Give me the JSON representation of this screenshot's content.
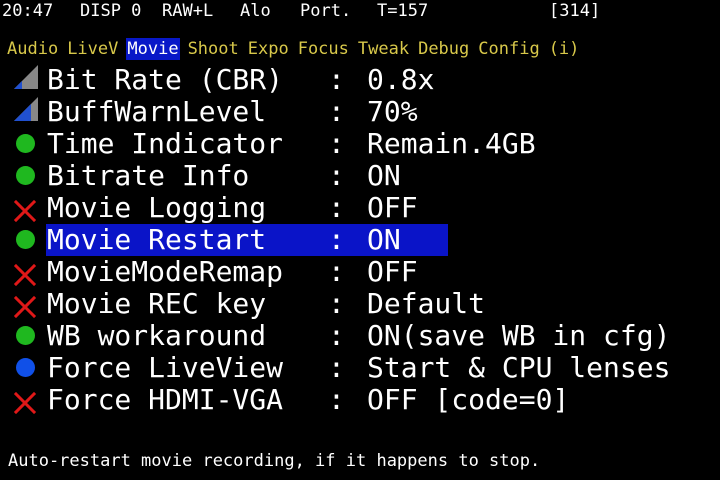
{
  "status": {
    "time": "20:47",
    "disp": "DISP 0",
    "quality": "RAW+L",
    "iso_mode": "Alo",
    "orientation": "Port.",
    "temperature": "T=157",
    "shots": "[314]"
  },
  "tabs": [
    {
      "label": "Audio",
      "active": false
    },
    {
      "label": "LiveV",
      "active": false
    },
    {
      "label": "Movie",
      "active": true
    },
    {
      "label": "Shoot",
      "active": false
    },
    {
      "label": "Expo",
      "active": false
    },
    {
      "label": "Focus",
      "active": false
    },
    {
      "label": "Tweak",
      "active": false
    },
    {
      "label": "Debug",
      "active": false
    },
    {
      "label": "Config",
      "active": false
    },
    {
      "label": "(i)",
      "active": false
    }
  ],
  "menu": {
    "items": [
      {
        "label": "Bit Rate (CBR)",
        "sep": ":",
        "value": "0.8x",
        "icon": "slider-gray-icon"
      },
      {
        "label": "BuffWarnLevel ",
        "sep": ":",
        "value": "70%",
        "icon": "slider-blue-icon"
      },
      {
        "label": "Time Indicator",
        "sep": ":",
        "value": "Remain.4GB",
        "icon": "green-dot-icon"
      },
      {
        "label": "Bitrate Info  ",
        "sep": ":",
        "value": "ON",
        "icon": "green-dot-icon"
      },
      {
        "label": "Movie Logging ",
        "sep": ":",
        "value": "OFF",
        "icon": "red-x-icon"
      },
      {
        "label": "Movie Restart ",
        "sep": ":",
        "value": "ON",
        "icon": "green-dot-icon",
        "selected": true
      },
      {
        "label": "MovieModeRemap",
        "sep": ":",
        "value": "OFF",
        "icon": "red-x-icon"
      },
      {
        "label": "Movie REC key ",
        "sep": ":",
        "value": "Default",
        "icon": "red-x-icon"
      },
      {
        "label": "WB workaround ",
        "sep": ":",
        "value": "ON(save WB in cfg)",
        "icon": "green-dot-icon"
      },
      {
        "label": "Force LiveView",
        "sep": ":",
        "value": "Start & CPU lenses",
        "icon": "blue-dot-icon"
      },
      {
        "label": "Force HDMI-VGA",
        "sep": ":",
        "value": "OFF [code=0]",
        "icon": "red-x-icon"
      }
    ]
  },
  "help_text": "Auto-restart movie recording, if it happens to stop.",
  "colors": {
    "background": "#000000",
    "tab_inactive": "#d8c84a",
    "highlight": "#0a14c8",
    "green": "#1fb81f",
    "red": "#e01818",
    "blue": "#1050e8"
  }
}
